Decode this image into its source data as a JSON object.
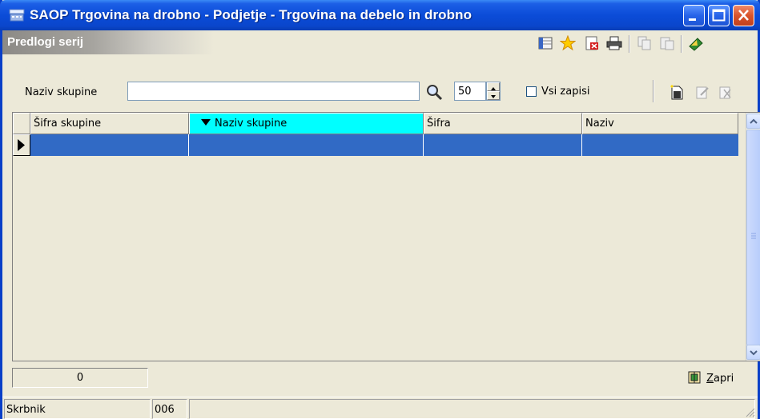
{
  "window": {
    "title": "SAOP Trgovina na drobno - Podjetje - Trgovina na debelo in drobno"
  },
  "section": {
    "title": "Predlogi serij"
  },
  "filter": {
    "group_label": "Naziv skupine",
    "group_value": "",
    "limit_value": "50",
    "all_records_label": "Vsi zapisi",
    "all_records_checked": false
  },
  "grid": {
    "columns": [
      "Šifra skupine",
      "Naziv skupine",
      "Šifra",
      "Naziv"
    ],
    "sorted_column": "Naziv skupine",
    "rows": [
      [
        "",
        "",
        "",
        ""
      ]
    ]
  },
  "footer": {
    "record_count": "0",
    "close_label": "Zapri"
  },
  "statusbar": {
    "user": "Skrbnik",
    "code": "006",
    "message": ""
  },
  "colors": {
    "titlebar": "#0a46cc",
    "selection": "#316ac5",
    "sorted_header": "#00ffff"
  }
}
